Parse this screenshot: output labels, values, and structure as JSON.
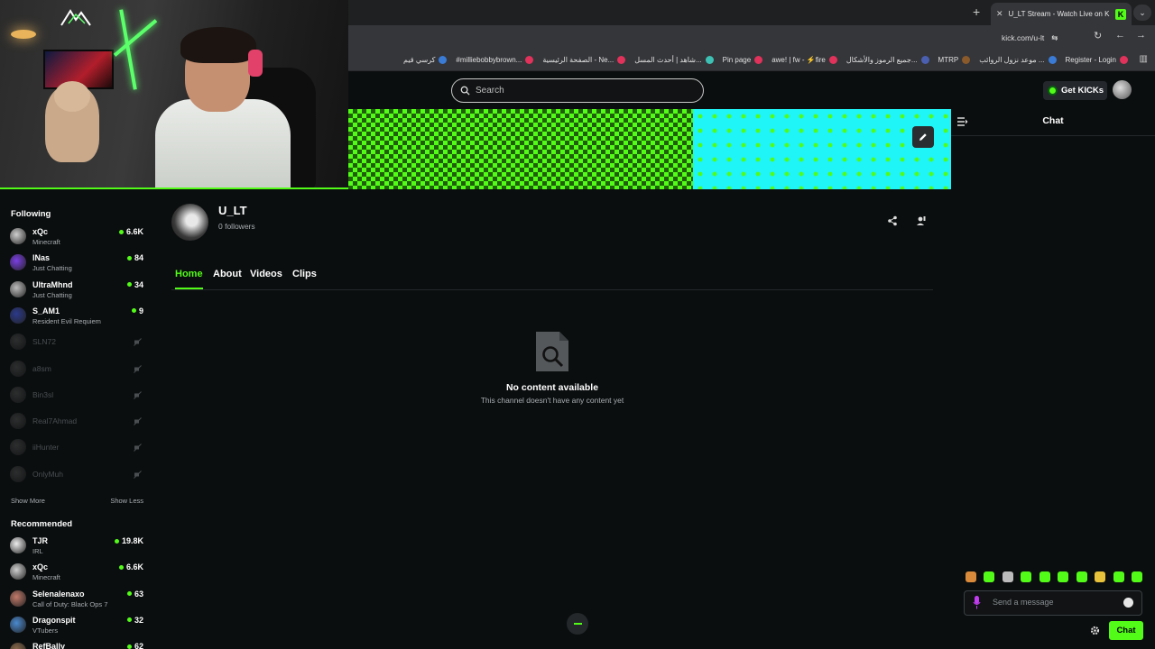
{
  "browser": {
    "active_tab_title": "U_LT Stream - Watch Live on Ki",
    "address": "kick.com/u-lt",
    "bookmarks": [
      {
        "label": "Register - Login",
        "color": "#e0325a"
      },
      {
        "label": "موعد نزول الروائب ...",
        "color": "#3a7bd5"
      },
      {
        "label": "MTRP",
        "color": "#8a5a2b"
      },
      {
        "label": "جميع الرموز والأشكال...",
        "color": "#4a5fb0"
      },
      {
        "label": "awe! | fw - ⚡fire",
        "color": "#e0325a"
      },
      {
        "label": "Pin page",
        "color": "#e0325a"
      },
      {
        "label": "شاهد | أحدث المسل...",
        "color": "#3ec1b5"
      },
      {
        "label": "الصفحة الرئيسية - Ne...",
        "color": "#e0325a"
      },
      {
        "label": "#milliebobbybrown...",
        "color": "#e0325a"
      },
      {
        "label": "كرسي قيم",
        "color": "#3a7bd5"
      }
    ]
  },
  "header": {
    "search_placeholder": "Search",
    "get_kicks": "Get KICKs"
  },
  "sidebar": {
    "following_title": "Following",
    "following": [
      {
        "name": "xQc",
        "category": "Minecraft",
        "viewers": "6.6K",
        "live": true,
        "color": "#cfcfcf"
      },
      {
        "name": "lNas",
        "category": "Just Chatting",
        "viewers": "84",
        "live": true,
        "color": "#7b3fe4"
      },
      {
        "name": "UltraMhnd",
        "category": "Just Chatting",
        "viewers": "34",
        "live": true,
        "color": "#bdbdbd"
      },
      {
        "name": "S_AM1",
        "category": "Resident Evil Requiem",
        "viewers": "9",
        "live": true,
        "color": "#2b3a8c"
      },
      {
        "name": "SLN72",
        "category": "",
        "viewers": "",
        "live": false,
        "color": "#6a6a6a"
      },
      {
        "name": "a8sm",
        "category": "",
        "viewers": "",
        "live": false,
        "color": "#6a6a6a"
      },
      {
        "name": "Bin3sl",
        "category": "",
        "viewers": "",
        "live": false,
        "color": "#6a6a6a"
      },
      {
        "name": "Real7Ahmad",
        "category": "",
        "viewers": "",
        "live": false,
        "color": "#6a6a6a"
      },
      {
        "name": "iiHunter",
        "category": "",
        "viewers": "",
        "live": false,
        "color": "#6a6a6a"
      },
      {
        "name": "OnlyMuh",
        "category": "",
        "viewers": "",
        "live": false,
        "color": "#6a6a6a"
      }
    ],
    "show_more": "Show More",
    "show_less": "Show Less",
    "recommended_title": "Recommended",
    "recommended": [
      {
        "name": "TJR",
        "category": "IRL",
        "viewers": "19.8K",
        "live": true,
        "color": "#eeeeee"
      },
      {
        "name": "xQc",
        "category": "Minecraft",
        "viewers": "6.6K",
        "live": true,
        "color": "#cfcfcf"
      },
      {
        "name": "Selenalenaxo",
        "category": "Call of Duty: Black Ops 7",
        "viewers": "63",
        "live": true,
        "color": "#c27a6a"
      },
      {
        "name": "Dragonspit",
        "category": "VTubers",
        "viewers": "32",
        "live": true,
        "color": "#4a8ad0"
      },
      {
        "name": "RefBally",
        "category": "",
        "viewers": "62",
        "live": true,
        "color": "#8a6a4a"
      }
    ]
  },
  "channel": {
    "name": "U_LT",
    "followers": "0 followers",
    "tabs": [
      "Home",
      "About",
      "Videos",
      "Clips"
    ],
    "empty_title": "No content available",
    "empty_subtitle": "This channel doesn't have any content yet"
  },
  "chat": {
    "title": "Chat",
    "placeholder": "Send a message",
    "send_label": "Chat",
    "emote_colors": [
      "#d98a3a",
      "#53fc18",
      "#bcbcbc",
      "#53fc18",
      "#53fc18",
      "#53fc18",
      "#53fc18",
      "#e8c23a",
      "#53fc18",
      "#53fc18"
    ]
  },
  "colors": {
    "accent": "#53fc18",
    "background": "#0b0e0f",
    "banner_cyan": "#1ff4f6"
  }
}
